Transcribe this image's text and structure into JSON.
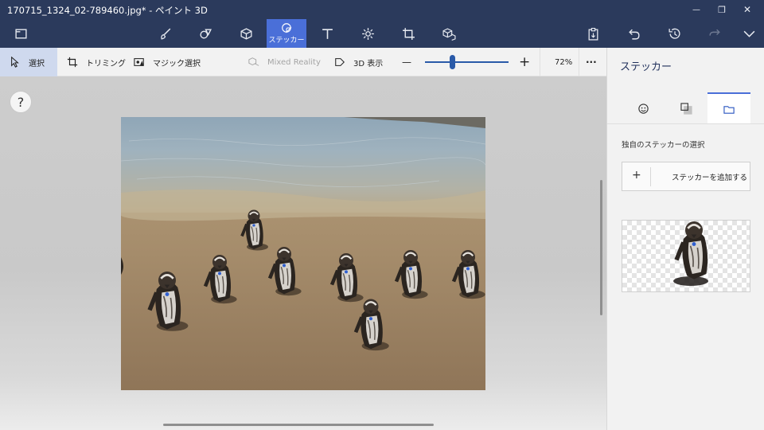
{
  "window": {
    "title": "170715_1324_02-789460.jpg* - ペイント 3D",
    "controls": {
      "minimize": "—",
      "restore": "❐",
      "close": "✕"
    }
  },
  "toolbar": {
    "active_label": "ステッカー",
    "tools": [
      "menu-icon",
      "brush-icon",
      "2d-shapes-icon",
      "3d-shapes-icon",
      "sticker-icon",
      "text-icon",
      "effects-icon",
      "canvas-icon",
      "3d-library-icon"
    ],
    "right_tools": [
      "paste-icon",
      "undo-icon",
      "history-icon",
      "redo-icon",
      "expand-icon"
    ]
  },
  "subbar": {
    "select": "選択",
    "crop": "トリミング",
    "magic_select": "マジック選択",
    "mixed_reality": "Mixed Reality",
    "view_3d": "3D 表示",
    "zoom_minus": "—",
    "zoom_plus": "+",
    "zoom_level": "72%",
    "zoom_fraction": 0.33,
    "more": "···"
  },
  "canvas": {
    "help": "?",
    "image_description": "penguins"
  },
  "panel": {
    "title": "ステッカー",
    "tabs": [
      "sticker-face-icon",
      "texture-icon",
      "custom-folder-icon"
    ],
    "section_label": "独自のステッカーの選択",
    "add_button": "ステッカーを追加する",
    "add_plus": "+"
  },
  "colors": {
    "titlebar": "#2b3a5c",
    "accent": "#4a6fd8",
    "panel_title": "#1f2f5a"
  }
}
